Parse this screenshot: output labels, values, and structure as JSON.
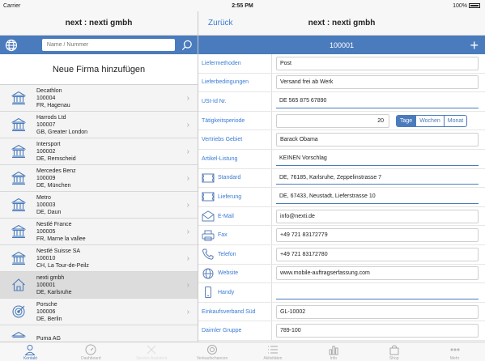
{
  "status": {
    "carrier": "Carrier",
    "time": "2:55 PM",
    "battery": "100%"
  },
  "left": {
    "title": "next : nexti gmbh",
    "search_placeholder": "Name / Nummer",
    "add_label": "Neue Firma hinzufügen",
    "companies": [
      {
        "name": "Decathlon",
        "number": "100004",
        "location": "FR, Hagenau",
        "icon": "bank-icon"
      },
      {
        "name": "Harrods Ltd",
        "number": "100007",
        "location": "GB, Greater London",
        "icon": "bank-icon"
      },
      {
        "name": "Intersport",
        "number": "100002",
        "location": "DE, Remscheid",
        "icon": "bank-icon"
      },
      {
        "name": "Mercedes Benz",
        "number": "100009",
        "location": "DE, München",
        "icon": "bank-icon"
      },
      {
        "name": "Metro",
        "number": "100003",
        "location": "DE, Daun",
        "icon": "bank-icon"
      },
      {
        "name": "Nestlé France",
        "number": "100005",
        "location": "FR, Marne la vallee",
        "icon": "bank-icon"
      },
      {
        "name": "Nestlé Suisse SA",
        "number": "100010",
        "location": "CH, La Tour-de-Peilz",
        "icon": "bank-icon"
      },
      {
        "name": "nexti gmbh",
        "number": "100001",
        "location": "DE, Karlsruhe",
        "icon": "home-icon"
      },
      {
        "name": "Porsche",
        "number": "100006",
        "location": "DE, Berlin",
        "icon": "target-icon"
      },
      {
        "name": "Puma AG",
        "number": "",
        "location": "",
        "icon": "bank-icon"
      }
    ]
  },
  "right": {
    "back_label": "Zurück",
    "title": "next : nexti gmbh",
    "number": "100001",
    "fields": [
      {
        "label": "Liefermethoden",
        "value": "Post"
      },
      {
        "label": "Lieferbedingungen",
        "value": "Versand frei ab Werk"
      },
      {
        "label": "USt-Id Nr.",
        "value": "DE 565 875 67890"
      },
      {
        "label": "Tätigkeitsperiode",
        "value": "20"
      },
      {
        "label": "Vertriebs Gebiet",
        "value": "Barack Obama"
      },
      {
        "label": "Artikel-Listung",
        "value": "KEINEN Vorschlag"
      },
      {
        "label": "Standard",
        "value": "DE, 76185, Karlsruhe, Zeppelinstrasse 7"
      },
      {
        "label": "Lieferung",
        "value": "DE, 67433, Neustadt, Lieferstrasse 10"
      },
      {
        "label": "E-Mail",
        "value": "info@nexti.de"
      },
      {
        "label": "Fax",
        "value": "+49 721 83172779"
      },
      {
        "label": "Telefon",
        "value": "+49 721 83172780"
      },
      {
        "label": "Website",
        "value": "www.mobile-auftragserfassung.com"
      },
      {
        "label": "Handy",
        "value": ""
      },
      {
        "label": "Einkaufsverband Süd",
        "value": "GL-10002"
      },
      {
        "label": "Daimler Gruppe",
        "value": "789-100"
      }
    ],
    "period_options": [
      "Tage",
      "Wochen",
      "Monat"
    ]
  },
  "tabs": [
    {
      "label": "Kontakt",
      "icon": "person-icon"
    },
    {
      "label": "Dashboard",
      "icon": "gauge-icon"
    },
    {
      "label": "Service Assistent",
      "icon": "tools-icon"
    },
    {
      "label": "Verkaufschancen",
      "icon": "target-icon"
    },
    {
      "label": "Aktivitäten",
      "icon": "list-icon"
    },
    {
      "label": "Info",
      "icon": "chart-icon"
    },
    {
      "label": "Shop",
      "icon": "bag-icon"
    },
    {
      "label": "Mehr",
      "icon": "more-icon"
    }
  ]
}
